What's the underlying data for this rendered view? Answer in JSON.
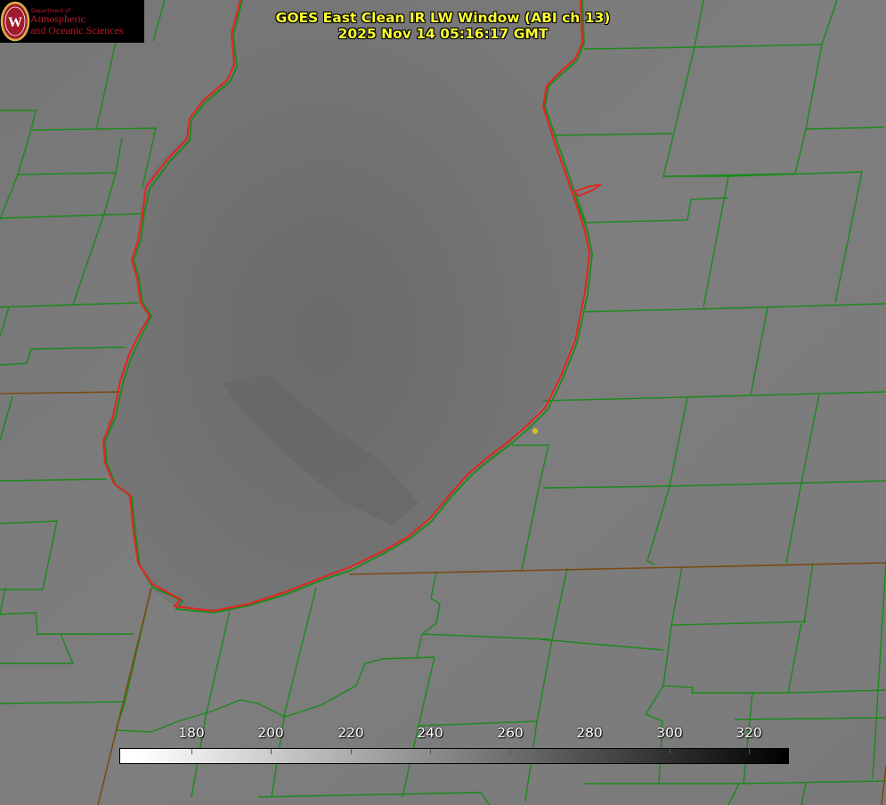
{
  "title": {
    "line1": "GOES East Clean IR LW Window (ABI ch 13)",
    "line2": "2025 Nov 14 05:16:17 GMT"
  },
  "logo": {
    "department": "Department of",
    "name_line1": "Atmospheric",
    "name_line2": "and Oceanic Sciences",
    "emblem": "W",
    "colors": {
      "background": "#000000",
      "text": "#c0192d",
      "shield": "#a01c2c",
      "shield_border": "#d9b24a"
    }
  },
  "colorbar": {
    "ticks": [
      "180",
      "200",
      "220",
      "240",
      "260",
      "280",
      "300",
      "320"
    ],
    "range": [
      165,
      330
    ],
    "cmap": "greys"
  },
  "map": {
    "icons": [
      "county-boundaries",
      "lake-shoreline",
      "state-boundaries",
      "site-marker"
    ],
    "colors": {
      "county_lines": "#1a8a1a",
      "state_lines": "#7a4a14",
      "shoreline": "#e6221e",
      "site_marker": "#d4c21c",
      "background_gray": "#7b7b7b",
      "lake_gray": "#6a6a6a"
    }
  }
}
